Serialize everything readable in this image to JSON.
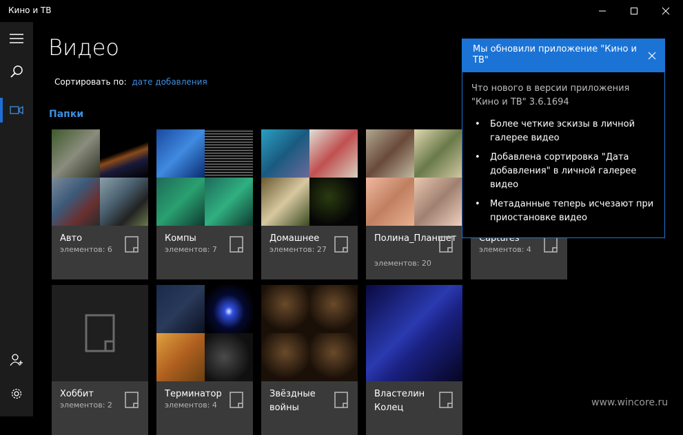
{
  "window": {
    "title": "Кино и ТВ",
    "minimize_icon": "minimize-icon",
    "maximize_icon": "maximize-icon",
    "close_icon": "close-icon"
  },
  "sidebar": {
    "items": [
      {
        "icon": "hamburger-menu-icon"
      },
      {
        "icon": "search-icon"
      },
      {
        "icon": "video-camera-icon",
        "active": true
      },
      {
        "icon": "add-user-icon"
      },
      {
        "icon": "gear-icon"
      }
    ],
    "accent": "#1d6fd6"
  },
  "page": {
    "title": "Видео",
    "sort_label": "Сортировать по:",
    "sort_value": "дате добавления",
    "section_title": "Папки"
  },
  "folders": [
    {
      "name": "Авто",
      "count": "элементов: 6"
    },
    {
      "name": "Компы",
      "count": "элементов: 7"
    },
    {
      "name": "Домашнее",
      "count": "элементов: 27"
    },
    {
      "name": "Полина_Планшет",
      "count": "элементов: 20"
    },
    {
      "name": "Captures",
      "count": "элементов: 4"
    },
    {
      "name": "Хоббит",
      "count": "элементов: 2"
    },
    {
      "name": "Терминатор",
      "count": "элементов: 4"
    },
    {
      "name": "Звёздные войны",
      "count": ""
    },
    {
      "name": "Властелин Колец",
      "count": ""
    }
  ],
  "toast": {
    "title": "Мы обновили приложение \"Кино и ТВ\"",
    "intro": "Что нового в версии приложения \"Кино и ТВ\" 3.6.1694",
    "items": [
      "Более четкие эскизы в личной галерее видео",
      "Добавлена сортировка \"Дата добавления\" в личной галерее видео",
      "Метаданные теперь исчезают при приостановке видео"
    ],
    "accent": "#1b73d6"
  },
  "watermark": "www.wincore.ru"
}
